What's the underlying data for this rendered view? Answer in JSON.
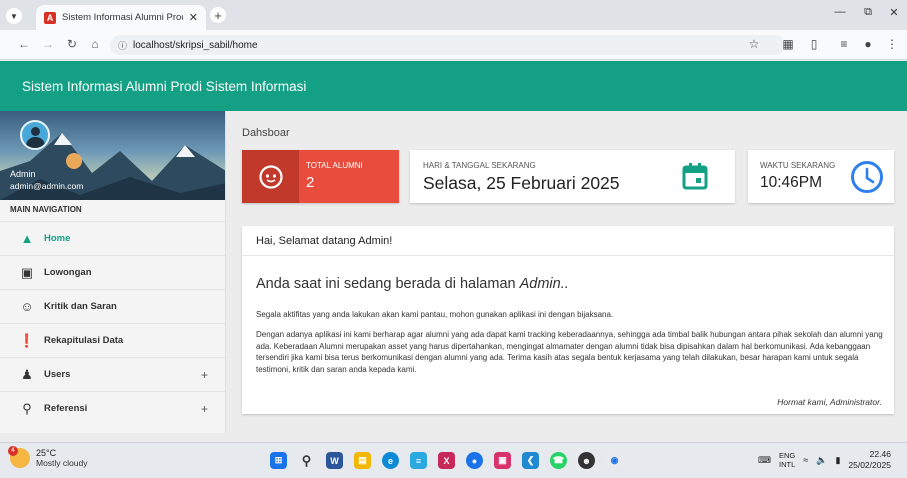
{
  "browser": {
    "tab_title": "Sistem Informasi Alumni Prodi",
    "url": "localhost/skripsi_sabil/home"
  },
  "app": {
    "title": "Sistem Informasi Alumni Prodi Sistem Informasi",
    "accent": "#14a085"
  },
  "sidebar": {
    "user_name": "Admin",
    "user_email": "admin@admin.com",
    "nav_header": "MAIN NAVIGATION",
    "items": [
      {
        "label": "Home",
        "icon": "home-icon"
      },
      {
        "label": "Lowongan",
        "icon": "briefcase-icon"
      },
      {
        "label": "Kritik dan Saran",
        "icon": "smiley-icon"
      },
      {
        "label": "Rekapitulasi Data",
        "icon": "alert-icon"
      },
      {
        "label": "Users",
        "icon": "users-icon",
        "expand": "+"
      },
      {
        "label": "Referensi",
        "icon": "search-icon",
        "expand": "+"
      }
    ]
  },
  "main": {
    "breadcrumb": "Dahsboar",
    "info_boxes": {
      "alumni_label": "TOTAL ALUMNI",
      "alumni_value": "2",
      "date_label": "HARI & TANGGAL SEKARANG",
      "date_value": "Selasa, 25 Februari 2025",
      "time_label": "WAKTU SEKARANG",
      "time_value": "10:46PM"
    },
    "card": {
      "header": "Hai, Selamat datang Admin!",
      "heading_prefix": "Anda saat ini sedang berada di halaman",
      "heading_em": "Admin..",
      "p1": "Segala aktifitas yang anda lakukan akan kami pantau, mohon gunakan aplikasi ini dengan bijaksana.",
      "p2": "Dengan adanya aplikasi ini kami berharap agar alumni yang ada dapat kami tracking keberadaannya, sehingga ada timbal balik hubungan antara pihak sekolah dan alumni yang ada. Keberadaan Alumni merupakan asset yang harus dipertahankan, mengingat almamater dengan alumni tidak bisa dipisahkan dalam hal berkomunikasi. Ada kebanggaan tersendiri jika kami bisa terus berkomunikasi dengan alumni yang ada. Terima kasih atas segala bentuk kerjasama yang telah dilakukan, besar harapan kami untuk segala testimoni, kritik dan saran anda kepada kami.",
      "signature": "Hormat kami, Administrator."
    }
  },
  "taskbar": {
    "temp": "25°C",
    "condition": "Mostly cloudy",
    "weather_badge": "4",
    "lang1": "ENG",
    "lang2": "INTL",
    "time": "22.46",
    "date": "25/02/2025"
  }
}
